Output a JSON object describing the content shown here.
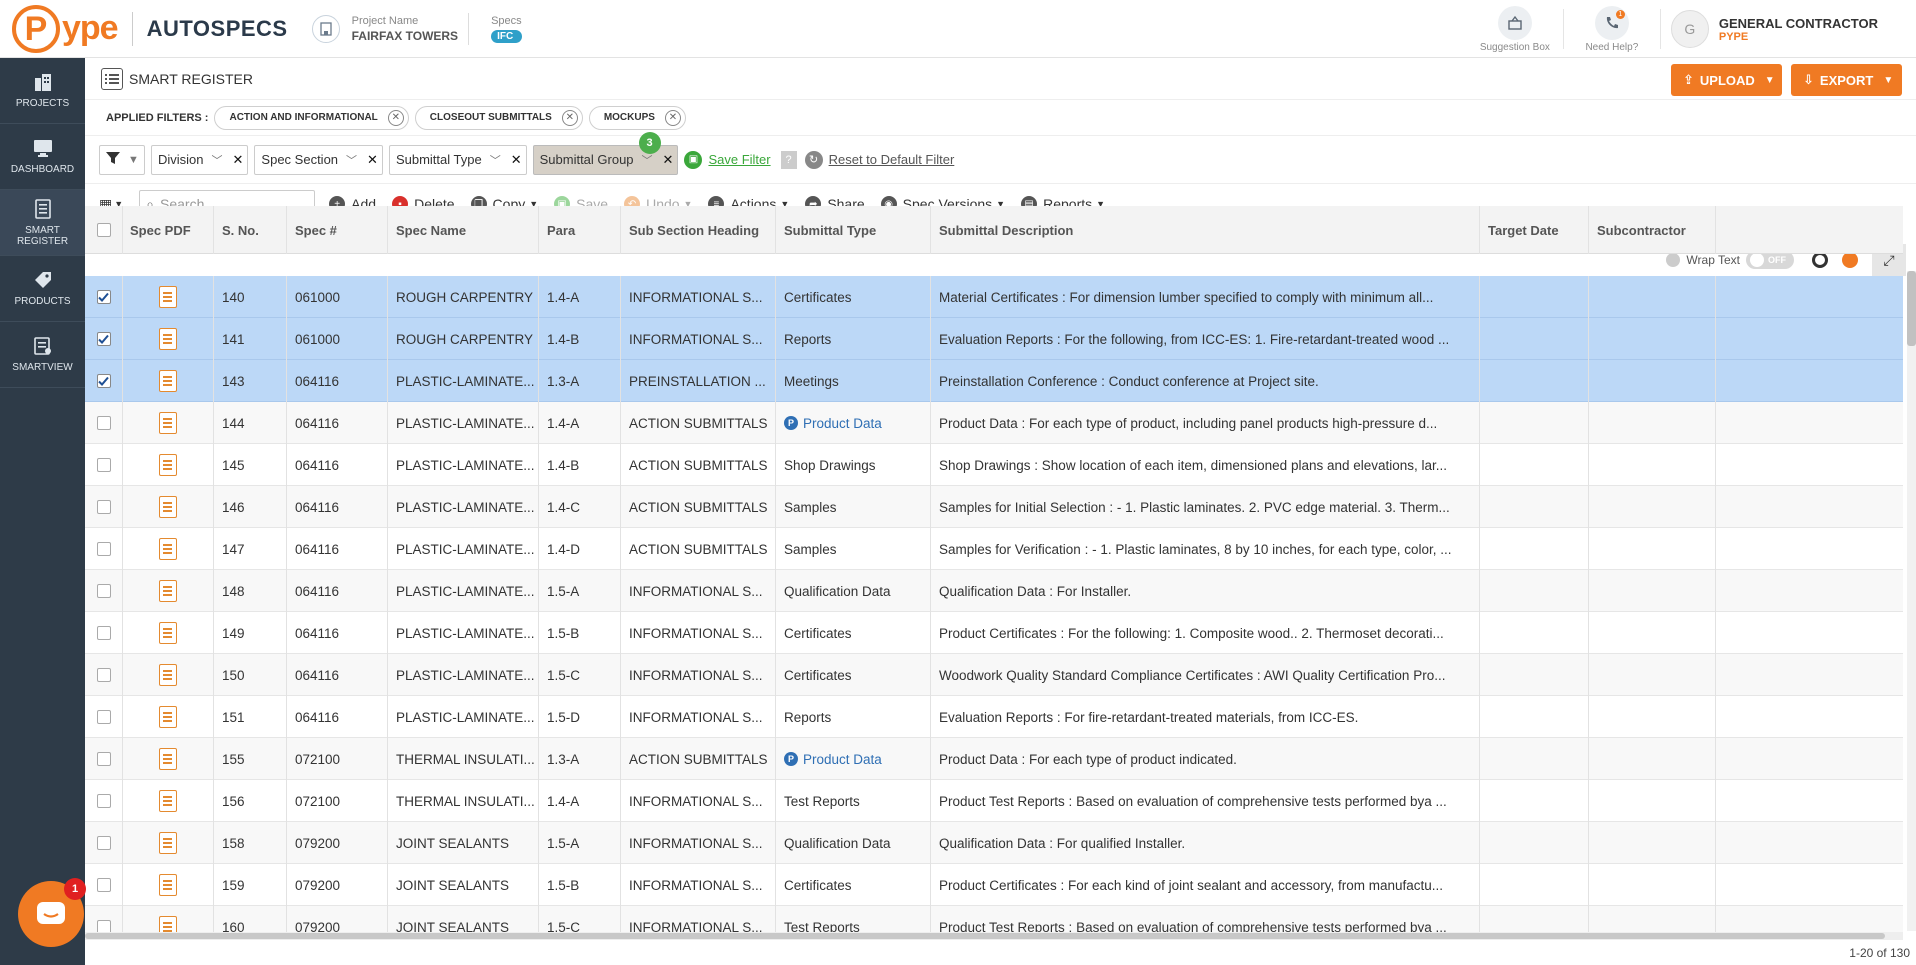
{
  "brand": {
    "logo_letter": "P",
    "logo_rest": "ype",
    "product": "AUTOSPECS"
  },
  "project": {
    "name_label": "Project Name",
    "name": "FAIRFAX TOWERS",
    "specs_label": "Specs",
    "specs_value": "IFC"
  },
  "topright": {
    "suggestion": "Suggestion Box",
    "help": "Need Help?",
    "help_badge": "1",
    "user_initial": "G",
    "user_name": "GENERAL CONTRACTOR",
    "user_company": "PYPE"
  },
  "sidebar": {
    "items": [
      {
        "label": "PROJECTS"
      },
      {
        "label": "DASHBOARD"
      },
      {
        "label": "SMART REGISTER"
      },
      {
        "label": "PRODUCTS"
      },
      {
        "label": "SMARTVIEW"
      }
    ]
  },
  "page": {
    "title": "SMART REGISTER",
    "upload": "UPLOAD",
    "export": "EXPORT"
  },
  "applied_filters": {
    "label": "APPLIED FILTERS :",
    "chips": [
      "ACTION AND INFORMATIONAL",
      "CLOSEOUT SUBMITTALS",
      "MOCKUPS"
    ]
  },
  "filterbar": {
    "division": "Division",
    "spec_section": "Spec Section",
    "submittal_type": "Submittal Type",
    "submittal_group": "Submittal Group",
    "group_count": "3",
    "save_filter": "Save Filter",
    "reset": "Reset to Default Filter"
  },
  "toolbar": {
    "search_placeholder": "Search",
    "add": "Add",
    "delete": "Delete",
    "copy": "Copy",
    "save": "Save",
    "undo": "Undo",
    "actions": "Actions",
    "share": "Share",
    "spec_versions": "Spec Versions",
    "reports": "Reports",
    "wrap_text": "Wrap Text",
    "toggle": "OFF"
  },
  "columns": [
    "Spec PDF",
    "S. No.",
    "Spec #",
    "Spec Name",
    "Para",
    "Sub Section Heading",
    "Submittal Type",
    "Submittal Description",
    "Target Date",
    "Subcontractor"
  ],
  "rows": [
    {
      "sel": true,
      "sno": "140",
      "spec": "061000",
      "name": "ROUGH CARPENTRY",
      "para": "1.4-A",
      "sub": "INFORMATIONAL S...",
      "type": "Certificates",
      "desc": "Material Certificates : For dimension lumber specified to comply with minimum all..."
    },
    {
      "sel": true,
      "sno": "141",
      "spec": "061000",
      "name": "ROUGH CARPENTRY",
      "para": "1.4-B",
      "sub": "INFORMATIONAL S...",
      "type": "Reports",
      "desc": "Evaluation Reports : For the following, from ICC-ES: 1. Fire-retardant-treated wood ..."
    },
    {
      "sel": true,
      "sno": "143",
      "spec": "064116",
      "name": "PLASTIC-LAMINATE...",
      "para": "1.3-A",
      "sub": "PREINSTALLATION ...",
      "type": "Meetings",
      "desc": "Preinstallation Conference : Conduct conference at Project site."
    },
    {
      "sel": false,
      "sno": "144",
      "spec": "064116",
      "name": "PLASTIC-LAMINATE...",
      "para": "1.4-A",
      "sub": "ACTION SUBMITTALS",
      "type": "Product Data",
      "pd": true,
      "desc": "Product Data : For each type of product, including panel products high-pressure d..."
    },
    {
      "sel": false,
      "sno": "145",
      "spec": "064116",
      "name": "PLASTIC-LAMINATE...",
      "para": "1.4-B",
      "sub": "ACTION SUBMITTALS",
      "type": "Shop Drawings",
      "desc": "Shop Drawings : Show location of each item, dimensioned plans and elevations, lar..."
    },
    {
      "sel": false,
      "sno": "146",
      "spec": "064116",
      "name": "PLASTIC-LAMINATE...",
      "para": "1.4-C",
      "sub": "ACTION SUBMITTALS",
      "type": "Samples",
      "desc": "Samples for Initial Selection : - 1. Plastic laminates. 2. PVC edge material. 3. Therm..."
    },
    {
      "sel": false,
      "sno": "147",
      "spec": "064116",
      "name": "PLASTIC-LAMINATE...",
      "para": "1.4-D",
      "sub": "ACTION SUBMITTALS",
      "type": "Samples",
      "desc": "Samples for Verification : - 1. Plastic laminates, 8 by 10 inches, for each type, color, ..."
    },
    {
      "sel": false,
      "sno": "148",
      "spec": "064116",
      "name": "PLASTIC-LAMINATE...",
      "para": "1.5-A",
      "sub": "INFORMATIONAL S...",
      "type": "Qualification Data",
      "desc": "Qualification Data : For Installer."
    },
    {
      "sel": false,
      "sno": "149",
      "spec": "064116",
      "name": "PLASTIC-LAMINATE...",
      "para": "1.5-B",
      "sub": "INFORMATIONAL S...",
      "type": "Certificates",
      "desc": "Product Certificates : For the following: 1. Composite wood.. 2. Thermoset decorati..."
    },
    {
      "sel": false,
      "sno": "150",
      "spec": "064116",
      "name": "PLASTIC-LAMINATE...",
      "para": "1.5-C",
      "sub": "INFORMATIONAL S...",
      "type": "Certificates",
      "desc": "Woodwork Quality Standard Compliance Certificates : AWI Quality Certification Pro..."
    },
    {
      "sel": false,
      "sno": "151",
      "spec": "064116",
      "name": "PLASTIC-LAMINATE...",
      "para": "1.5-D",
      "sub": "INFORMATIONAL S...",
      "type": "Reports",
      "desc": "Evaluation Reports : For fire-retardant-treated materials, from ICC-ES."
    },
    {
      "sel": false,
      "sno": "155",
      "spec": "072100",
      "name": "THERMAL INSULATI...",
      "para": "1.3-A",
      "sub": "ACTION SUBMITTALS",
      "type": "Product Data",
      "pd": true,
      "desc": "Product Data : For each type of product indicated."
    },
    {
      "sel": false,
      "sno": "156",
      "spec": "072100",
      "name": "THERMAL INSULATI...",
      "para": "1.4-A",
      "sub": "INFORMATIONAL S...",
      "type": "Test Reports",
      "desc": "Product Test Reports : Based on evaluation of comprehensive tests performed bya ..."
    },
    {
      "sel": false,
      "sno": "158",
      "spec": "079200",
      "name": "JOINT SEALANTS",
      "para": "1.5-A",
      "sub": "INFORMATIONAL S...",
      "type": "Qualification Data",
      "desc": "Qualification Data : For qualified Installer."
    },
    {
      "sel": false,
      "sno": "159",
      "spec": "079200",
      "name": "JOINT SEALANTS",
      "para": "1.5-B",
      "sub": "INFORMATIONAL S...",
      "type": "Certificates",
      "desc": "Product Certificates : For each kind of joint sealant and accessory, from manufactu..."
    },
    {
      "sel": false,
      "sno": "160",
      "spec": "079200",
      "name": "JOINT SEALANTS",
      "para": "1.5-C",
      "sub": "INFORMATIONAL S...",
      "type": "Test Reports",
      "desc": "Product Test Reports : Based on evaluation of comprehensive tests performed bya ..."
    }
  ],
  "pagination": "1-20 of 130",
  "chat_badge": "1",
  "colors": {
    "accent": "#f07a23",
    "sidebar": "#2e3b48",
    "selected_row": "#bcd8f7",
    "green": "#3aa73a"
  }
}
